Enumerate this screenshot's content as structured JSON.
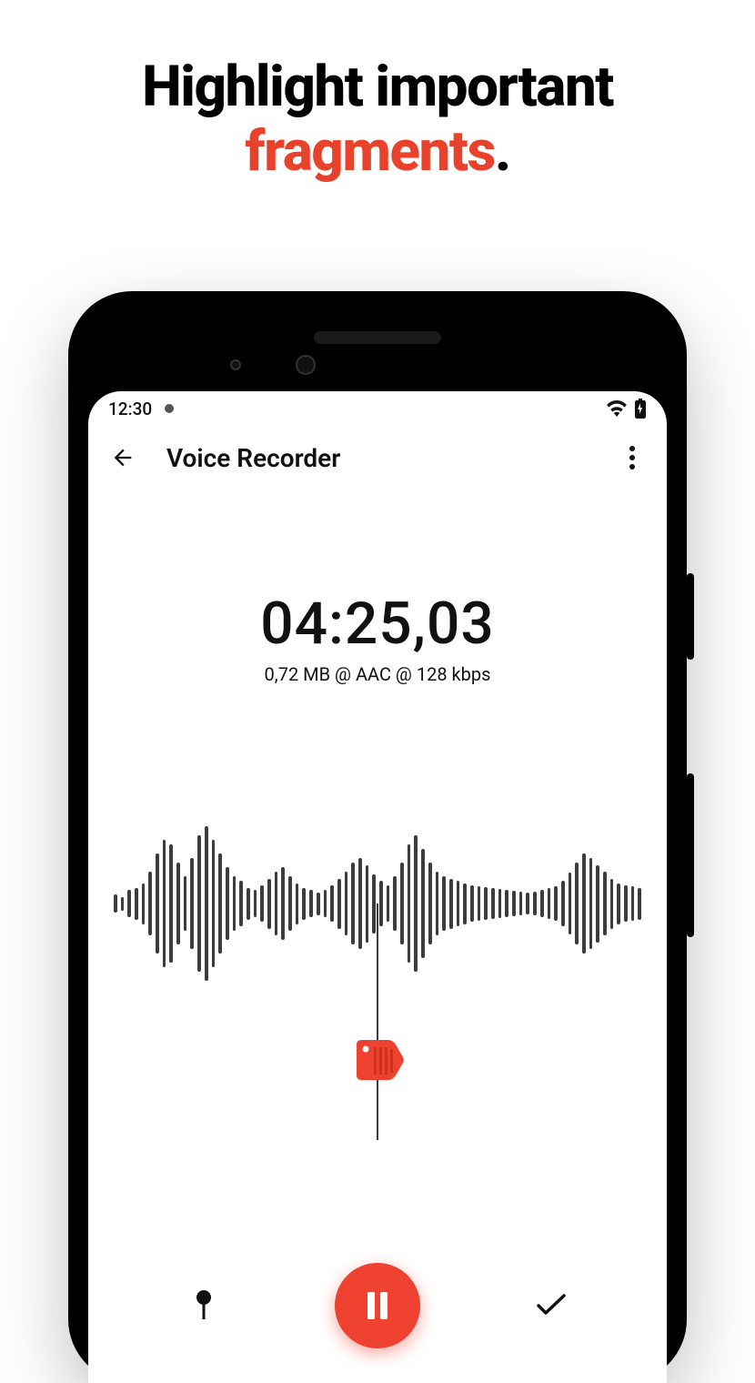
{
  "hero": {
    "line1": "Highlight important",
    "line2_accent": "fragments",
    "line2_tail": "."
  },
  "statusbar": {
    "time": "12:30"
  },
  "appbar": {
    "title": "Voice Recorder"
  },
  "recorder": {
    "timer": "04:25,03",
    "meta": "0,72 MB @ AAC @ 128 kbps"
  },
  "colors": {
    "accent": "#e8412c",
    "record": "#ee4130"
  },
  "waveform_heights": [
    20,
    15,
    30,
    35,
    45,
    70,
    110,
    140,
    130,
    90,
    60,
    100,
    150,
    170,
    140,
    110,
    80,
    60,
    50,
    35,
    30,
    40,
    55,
    70,
    80,
    60,
    45,
    35,
    30,
    25,
    30,
    40,
    55,
    70,
    90,
    100,
    85,
    65,
    50,
    40,
    60,
    90,
    130,
    150,
    120,
    90,
    70,
    60,
    55,
    50,
    45,
    40,
    38,
    36,
    34,
    32,
    30,
    28,
    26,
    24,
    26,
    30,
    34,
    38,
    50,
    68,
    90,
    110,
    100,
    85,
    70,
    55,
    45,
    40,
    38,
    35
  ]
}
